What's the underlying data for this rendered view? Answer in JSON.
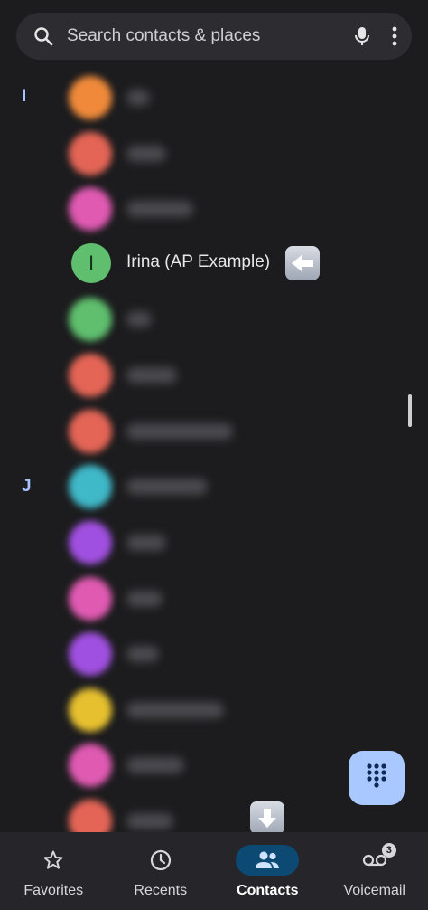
{
  "search": {
    "placeholder": "Search contacts & places"
  },
  "sections": [
    {
      "letter": "I"
    },
    {
      "letter": "J"
    }
  ],
  "contacts": {
    "focused": {
      "name": "Irina (AP Example)",
      "initial": "I",
      "avatar_color": "#5fbf6e"
    },
    "blurred_colors": [
      "#f08a3a",
      "#e46556",
      "#e05ab2",
      "#5fbf6e",
      "#e46556",
      "#e46556",
      "#3fb8c8",
      "#a050e0",
      "#e05ab2",
      "#a050e0",
      "#e6c02f",
      "#e05ab2",
      "#e46556"
    ]
  },
  "nav": {
    "items": [
      {
        "label": "Favorites",
        "icon": "star-icon"
      },
      {
        "label": "Recents",
        "icon": "clock-icon"
      },
      {
        "label": "Contacts",
        "icon": "people-icon",
        "active": true
      },
      {
        "label": "Voicemail",
        "icon": "voicemail-icon",
        "badge": "3"
      }
    ]
  },
  "colors": {
    "background": "#1c1c1e",
    "accent": "#a9c8ff",
    "active_nav": "#0d4a73"
  }
}
